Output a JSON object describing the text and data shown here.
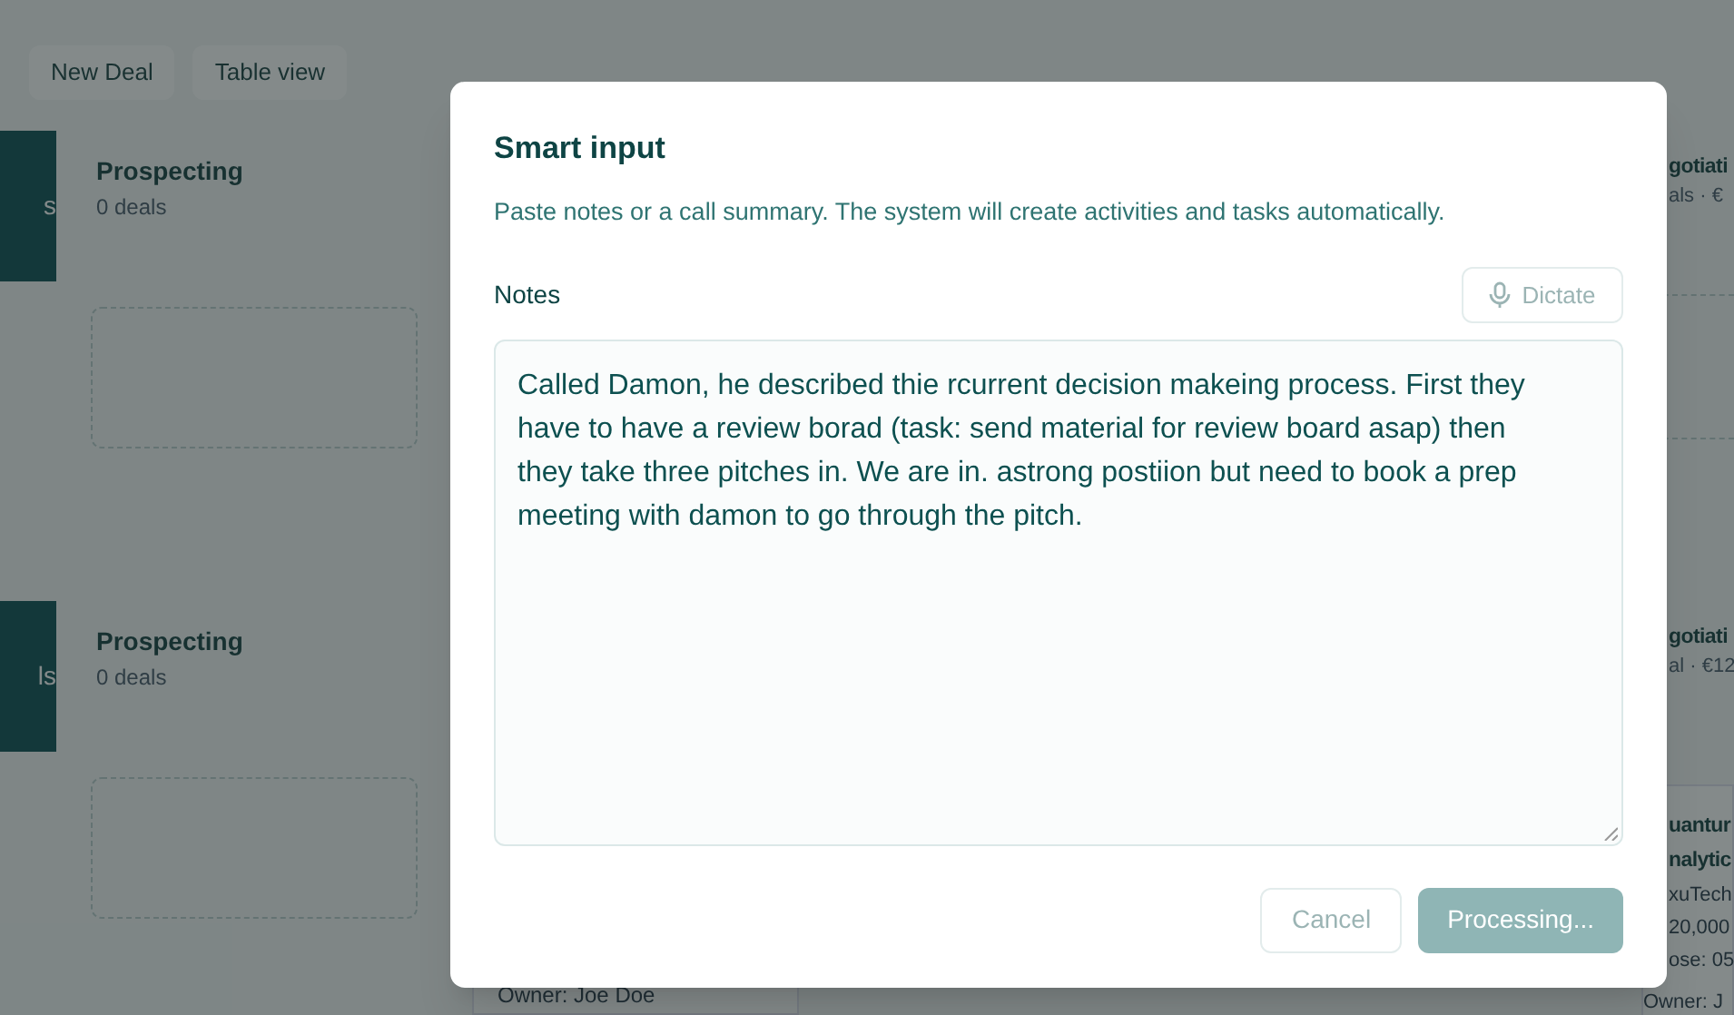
{
  "toolbar": {
    "buttons": [
      "New Deal",
      "Table view"
    ]
  },
  "lanes": [
    {
      "label": "s",
      "columns": [
        {
          "title": "Prospecting",
          "count": "0 deals"
        }
      ],
      "right": {
        "title": "gotiati",
        "count": "als · €"
      }
    },
    {
      "label": "ls",
      "columns": [
        {
          "title": "Prospecting",
          "count": "0 deals"
        }
      ],
      "right": {
        "title": "gotiati",
        "count": "al · €12"
      },
      "right_card": [
        "uantur",
        "nalytic",
        "xuTech",
        "20,000",
        "ose: 05",
        "Owner: J"
      ],
      "bottom_card": "Owner: Joe Doe"
    }
  ],
  "modal": {
    "title": "Smart input",
    "description": "Paste notes or a call summary. The system will create activities and tasks automatically.",
    "notes_label": "Notes",
    "dictate": {
      "label": "Dictate",
      "disabled": true
    },
    "notes": "Called Damon, he described thie rcurrent  decision makeing process. First they have to have a review borad (task: send material for review board asap) then they take three pitches in. We are in. astrong postiion but need to book a prep meeting with damon to go through the pitch.",
    "cancel": {
      "label": "Cancel",
      "disabled": true
    },
    "submit": {
      "label": "Processing...",
      "disabled": true
    }
  }
}
